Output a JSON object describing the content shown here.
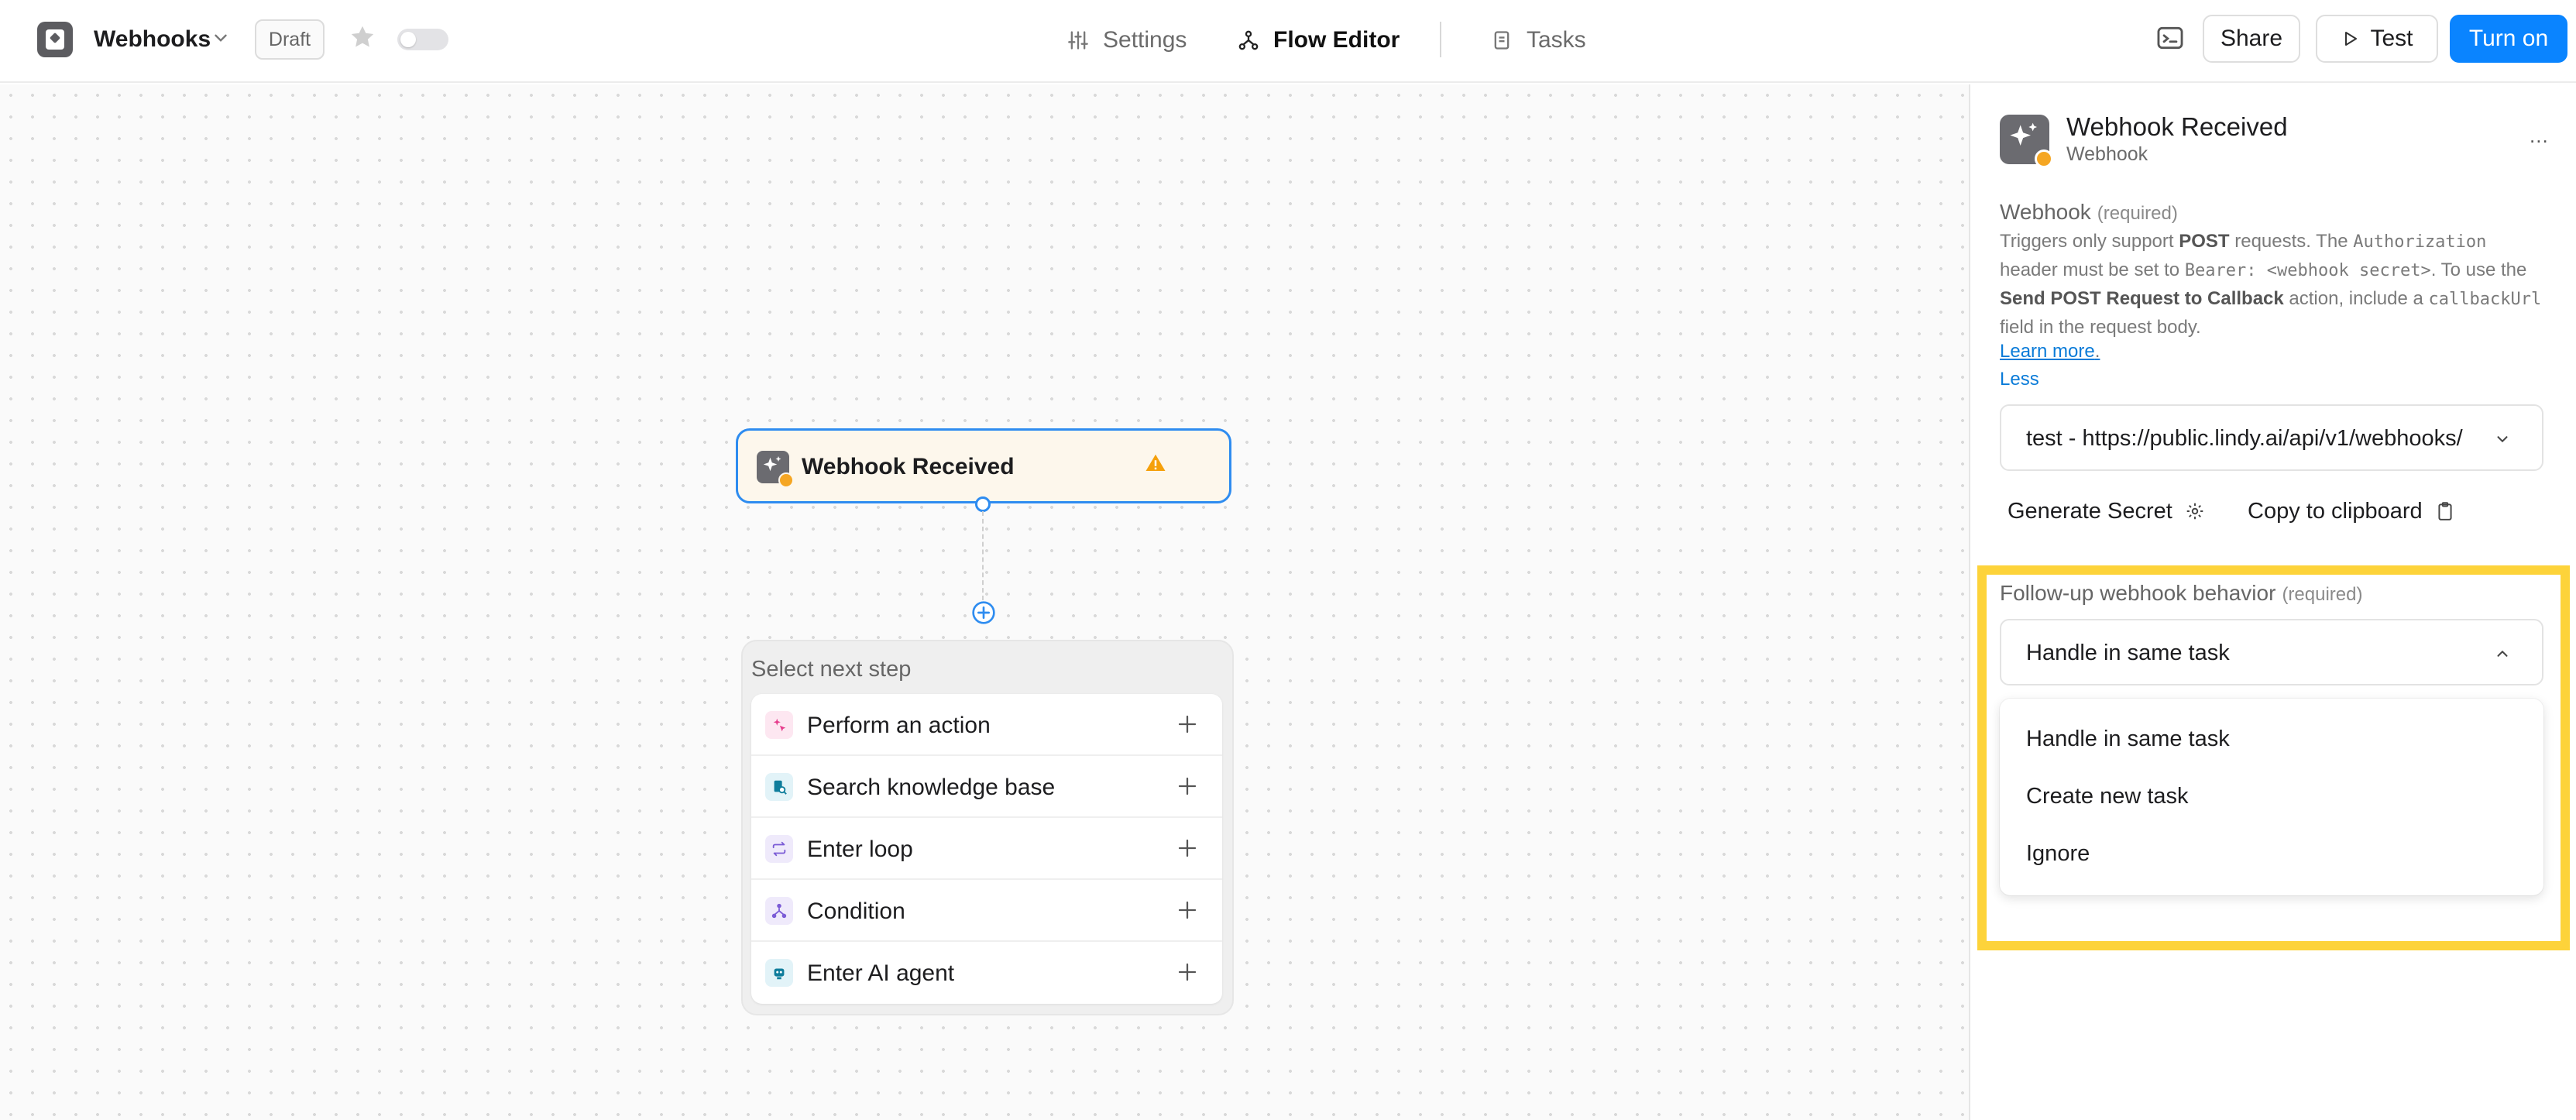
{
  "header": {
    "flow_name": "Webhooks",
    "status_badge": "Draft",
    "nav": {
      "settings": "Settings",
      "flow_editor": "Flow Editor",
      "tasks": "Tasks"
    },
    "buttons": {
      "share": "Share",
      "test": "Test",
      "turn_on": "Turn on"
    },
    "accent_color": "#0a84ff"
  },
  "canvas": {
    "trigger_node": {
      "title": "Webhook Received",
      "icon": "webhook-sparkle-icon",
      "warning_icon": "warning-triangle-icon"
    },
    "next_step": {
      "title": "Select next step",
      "items": [
        {
          "label": "Perform an action",
          "icon": "sparkle-cursor-icon",
          "color": "#e63c8c"
        },
        {
          "label": "Search knowledge base",
          "icon": "knowledge-base-icon",
          "color": "#0f7d9c"
        },
        {
          "label": "Enter loop",
          "icon": "loop-icon",
          "color": "#7b5cd6"
        },
        {
          "label": "Condition",
          "icon": "branch-icon",
          "color": "#7b5cd6"
        },
        {
          "label": "Enter AI agent",
          "icon": "robot-icon",
          "color": "#0f7d9c"
        }
      ]
    }
  },
  "panel": {
    "title": "Webhook Received",
    "subtitle": "Webhook",
    "more": "...",
    "webhook_section": {
      "label": "Webhook",
      "required": "(required)",
      "desc": {
        "t1": "Triggers only support ",
        "b1": "POST",
        "t2": " requests. The ",
        "c1": "Authorization",
        "t3": " header must be set to ",
        "c2": "Bearer: <webhook secret>",
        "t4": ". To use the ",
        "b2": "Send POST Request to Callback",
        "t5": " action, include a ",
        "c3": "callbackUrl",
        "t6": " field in the request body."
      },
      "learn_more": "Learn more",
      "less": "Less",
      "selected_url": "test - https://public.lindy.ai/api/v1/webhooks/",
      "generate_secret": "Generate Secret",
      "copy_clipboard": "Copy to clipboard"
    },
    "followup_section": {
      "label": "Follow-up webhook behavior",
      "required": "(required)",
      "selected": "Handle in same task",
      "options": [
        "Handle in same task",
        "Create new task",
        "Ignore"
      ],
      "highlight_color": "#fdd33a"
    }
  }
}
